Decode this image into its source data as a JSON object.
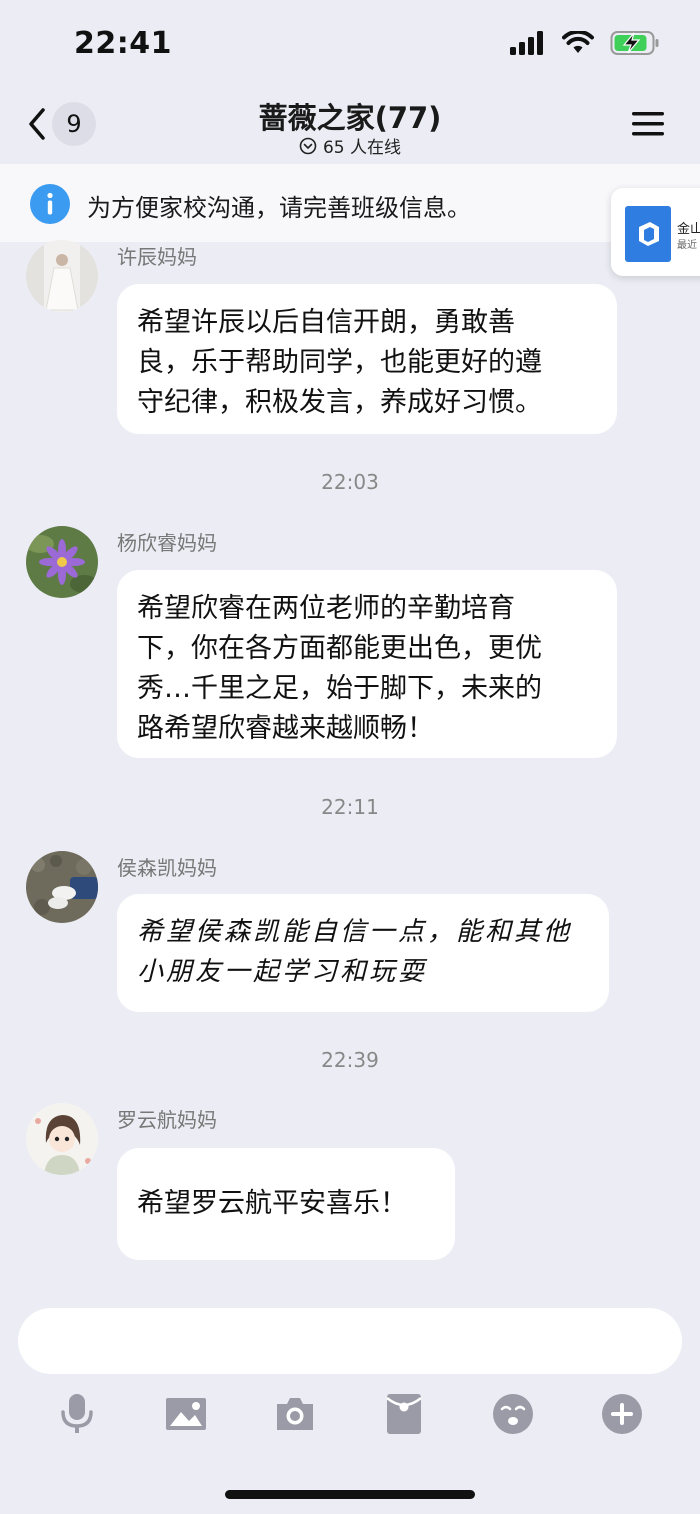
{
  "status_bar": {
    "time": "22:41"
  },
  "header": {
    "back_count": "9",
    "title": "蔷薇之家(77)",
    "online": "65 人在线"
  },
  "notice": {
    "icon": "info-icon",
    "text": "为方便家校沟通，请完善班级信息。"
  },
  "floating_card": {
    "line1": "金山",
    "line2": "最近"
  },
  "messages": [
    {
      "sender": "许辰妈妈",
      "lines": [
        "希望许辰以后自信开朗，勇敢善",
        "良，乐于帮助同学，也能更好的遵",
        "守纪律，积极发言，养成好习惯。"
      ]
    },
    {
      "timestamp": "22:03",
      "sender": "杨欣睿妈妈",
      "lines": [
        "希望欣睿在两位老师的辛勤培育",
        "下，你在各方面都能更出色，更优",
        "秀…千里之足，始于脚下，未来的",
        "路希望欣睿越来越顺畅！"
      ]
    },
    {
      "timestamp": "22:11",
      "sender": "侯森凯妈妈",
      "lines": [
        "希望侯森凯能自信一点，能和其他",
        "小朋友一起学习和玩耍"
      ]
    },
    {
      "timestamp": "22:39",
      "sender": "罗云航妈妈",
      "lines": [
        "希望罗云航平安喜乐！"
      ]
    }
  ],
  "input": {
    "placeholder": ""
  },
  "toolbar": {
    "icons": [
      "microphone-icon",
      "image-icon",
      "camera-icon",
      "red-packet-icon",
      "emoji-icon",
      "plus-icon"
    ]
  },
  "colors": {
    "background": "#ecedf4",
    "bubble": "#ffffff",
    "info_blue": "#3a9bf0",
    "toolbar_icon": "#9a9ba6"
  }
}
